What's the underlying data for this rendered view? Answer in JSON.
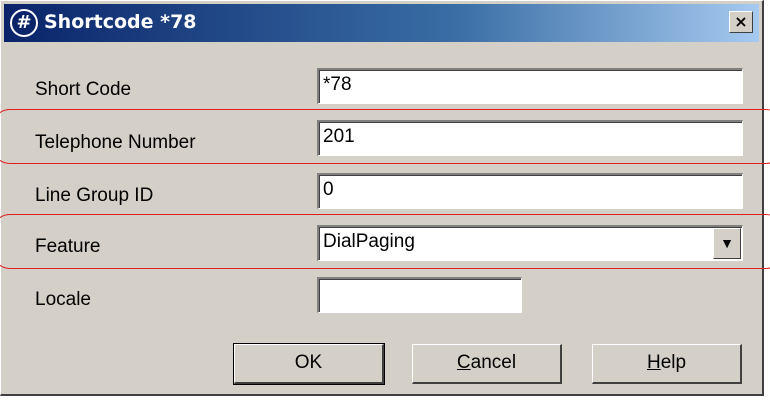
{
  "window": {
    "title": "Shortcode *78",
    "icon": "hash-icon",
    "close_label": "×"
  },
  "fields": {
    "short_code": {
      "label": "Short Code",
      "value": "*78"
    },
    "telephone_number": {
      "label": "Telephone Number",
      "value": "201"
    },
    "line_group_id": {
      "label": "Line Group ID",
      "value": "0"
    },
    "feature": {
      "label": "Feature",
      "value": "DialPaging"
    },
    "locale": {
      "label": "Locale",
      "value": ""
    }
  },
  "buttons": {
    "ok": {
      "label": "OK"
    },
    "cancel": {
      "accel": "C",
      "rest": "ancel"
    },
    "help": {
      "accel": "H",
      "rest": "elp"
    }
  },
  "colors": {
    "dialog_background": "#d4d0c8",
    "titlebar_start": "#0a246a",
    "titlebar_end": "#a6caf0",
    "highlight": "#e02020"
  }
}
